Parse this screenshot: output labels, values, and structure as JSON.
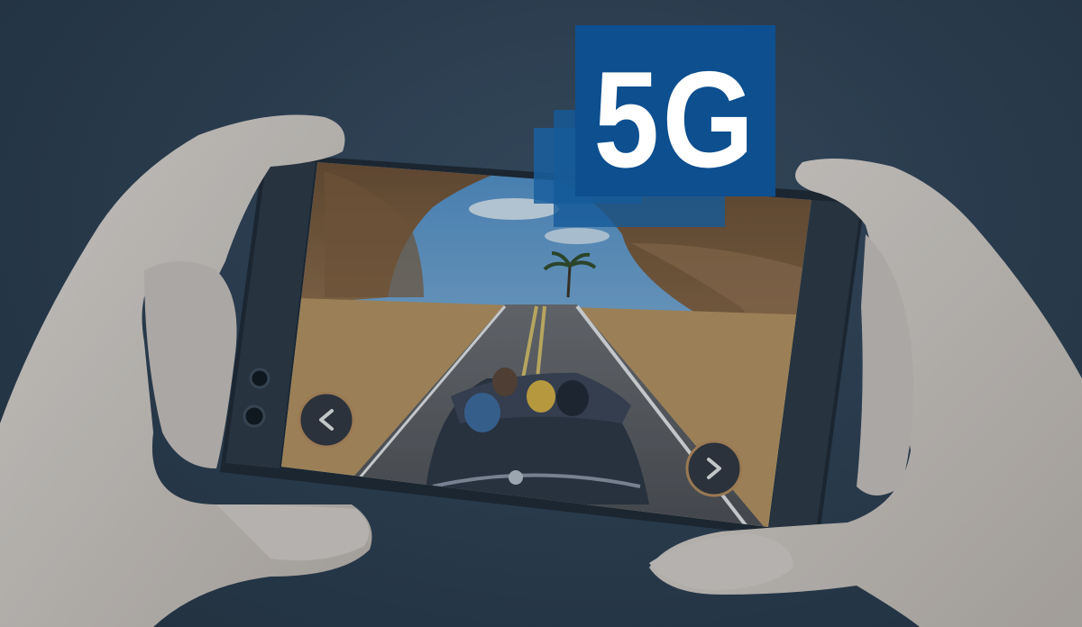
{
  "badge": {
    "label": "5G"
  },
  "game_controls": {
    "left_icon": "chevron-left-icon",
    "right_icon": "chevron-right-icon"
  },
  "colors": {
    "background": "#2d3f52",
    "badge_primary": "#0d4f8f",
    "badge_secondary": "#1a5f9f",
    "badge_text": "#ffffff",
    "phone_body": "#1c2530",
    "sky": "#6ea8d6",
    "sand": "#b8935e",
    "road": "#55575c",
    "skin": "#d9d2cc"
  }
}
